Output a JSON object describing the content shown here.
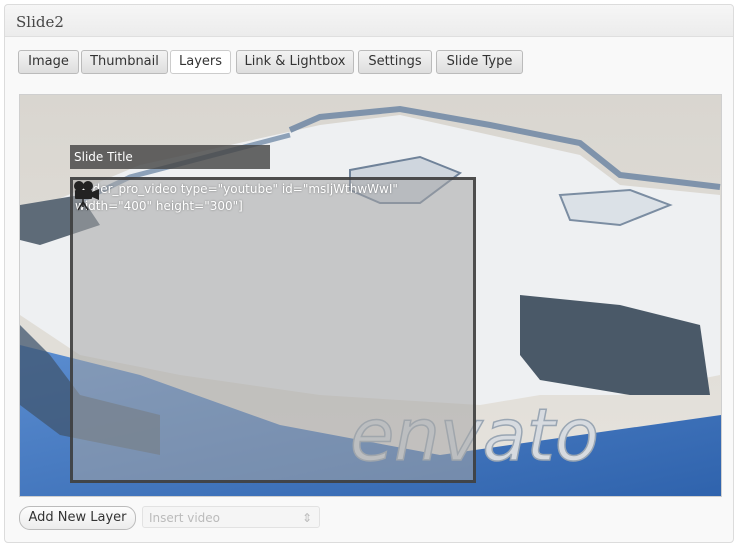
{
  "panel": {
    "title": "Slide2"
  },
  "tabs": [
    {
      "label": "Image",
      "active": false
    },
    {
      "label": "Thumbnail",
      "active": false
    },
    {
      "label": "Layers",
      "active": true
    },
    {
      "label": "Link & Lightbox",
      "active": false
    },
    {
      "label": "Settings",
      "active": false
    },
    {
      "label": "Slide Type",
      "active": false
    }
  ],
  "stage": {
    "background_watermark": "envato",
    "layers": {
      "title_text": "Slide Title",
      "video_shortcode": "[slider_pro_video type=\"youtube\" id=\"msIjWthwWwI\" width=\"400\" height=\"300\"]",
      "video_icon": "movie-camera-icon"
    }
  },
  "footer": {
    "add_layer_label": "Add New Layer",
    "insert_select_value": "Insert video"
  },
  "colors": {
    "active_tab_bg": "#ffffff",
    "title_layer_bg": "#464646",
    "sky_blue": "#3a6fb5"
  }
}
